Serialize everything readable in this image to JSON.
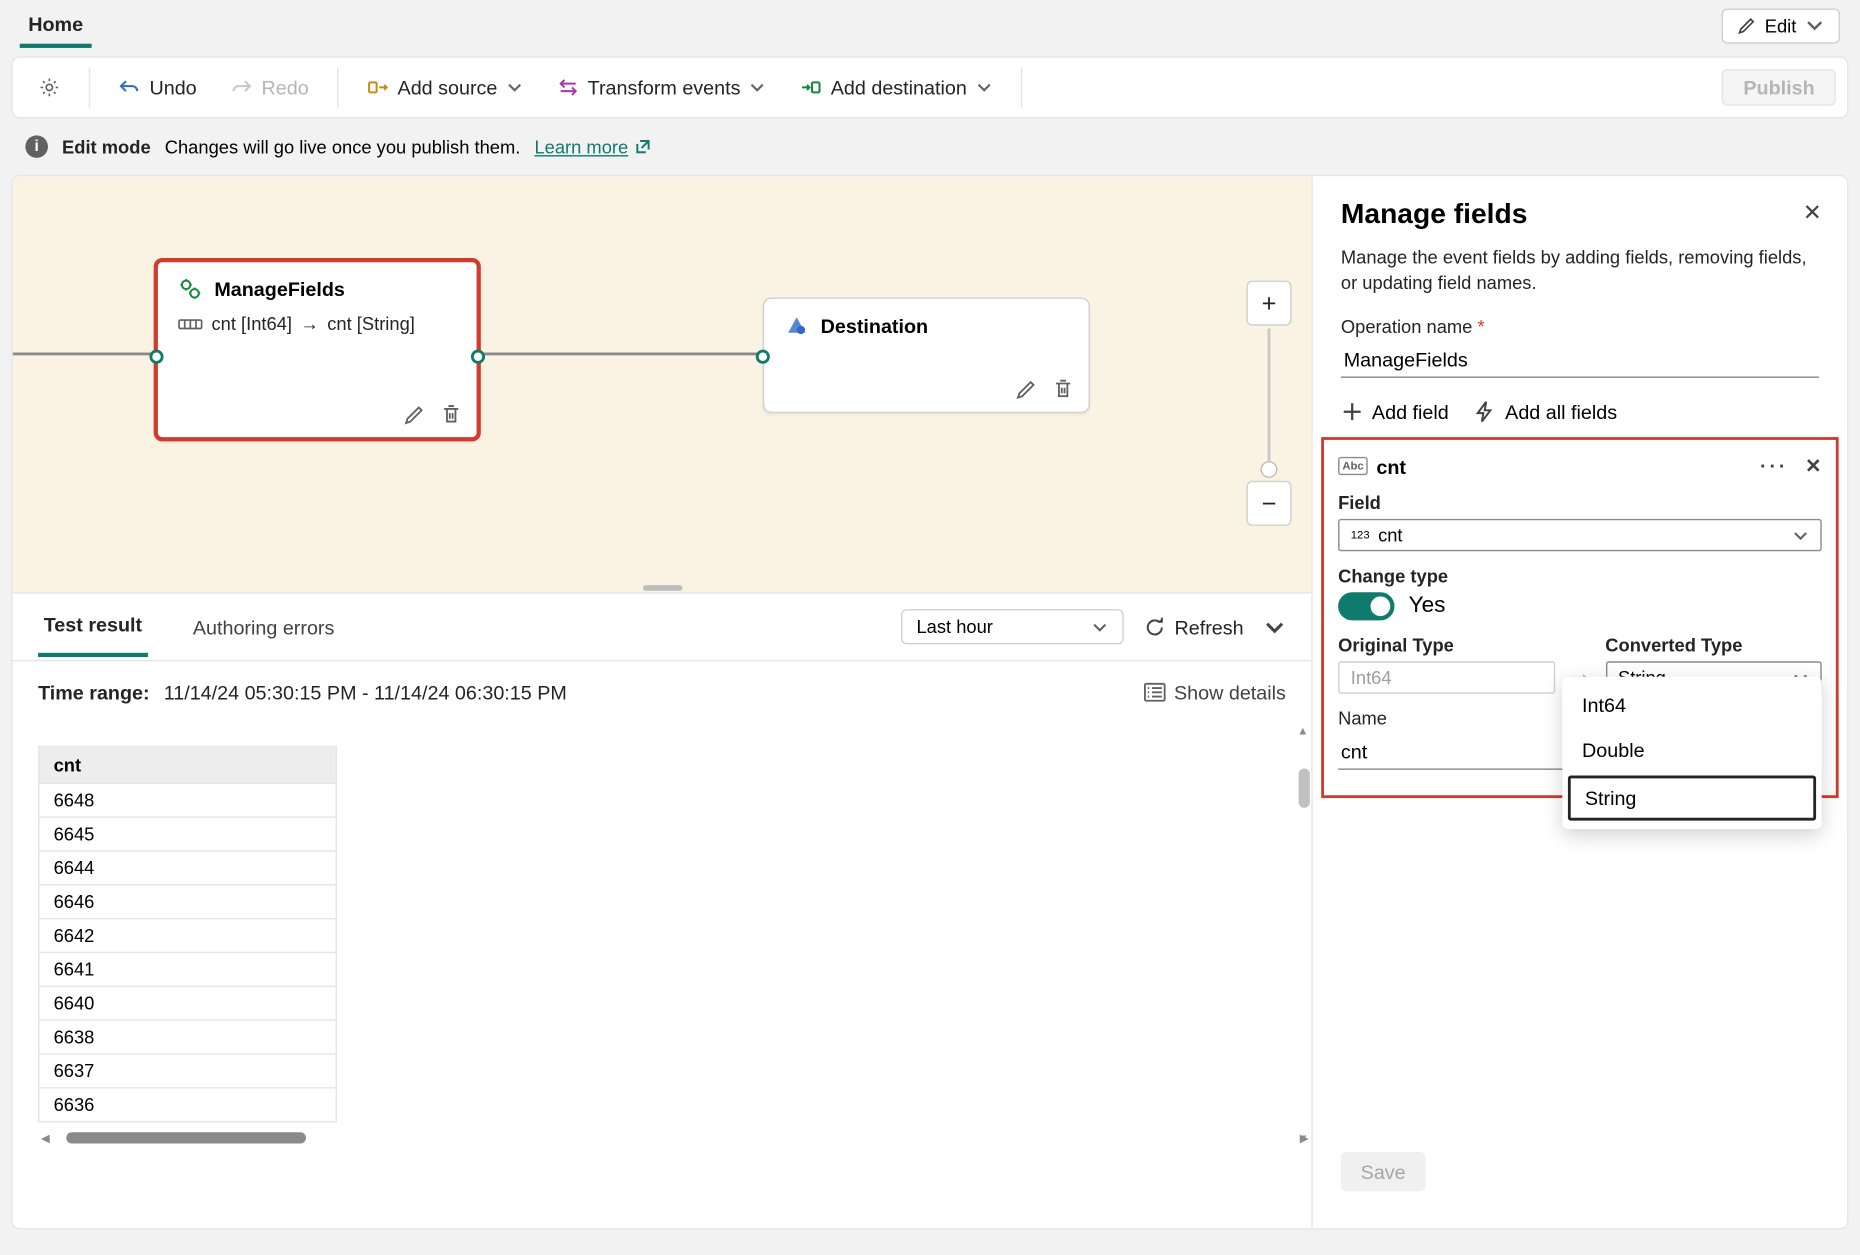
{
  "tabs": {
    "home": "Home"
  },
  "top_edit": "Edit",
  "toolbar": {
    "undo": "Undo",
    "redo": "Redo",
    "add_source": "Add source",
    "transform": "Transform events",
    "add_dest": "Add destination",
    "publish": "Publish"
  },
  "info": {
    "mode": "Edit mode",
    "msg": "Changes will go live once you publish them.",
    "link": "Learn more"
  },
  "nodes": {
    "manage": {
      "title": "ManageFields",
      "body_left": "cnt [Int64]",
      "body_right": "cnt [String]"
    },
    "dest": {
      "title": "Destination"
    }
  },
  "result_tabs": {
    "test": "Test result",
    "errors": "Authoring errors"
  },
  "time_range_label": "Time range:",
  "time_range_value": "11/14/24 05:30:15 PM  -  11/14/24 06:30:15 PM",
  "time_sel": "Last hour",
  "refresh": "Refresh",
  "show_details": "Show details",
  "table": {
    "col": "cnt",
    "rows": [
      "6648",
      "6645",
      "6644",
      "6646",
      "6642",
      "6641",
      "6640",
      "6638",
      "6637",
      "6636"
    ]
  },
  "panel": {
    "title": "Manage fields",
    "desc": "Manage the event fields by adding fields, removing fields, or updating field names.",
    "op_label": "Operation name",
    "op_value": "ManageFields",
    "add_field": "Add field",
    "add_all": "Add all fields",
    "card": {
      "name": "cnt",
      "field_lbl": "Field",
      "field_val": "cnt",
      "change_lbl": "Change type",
      "yes": "Yes",
      "orig_lbl": "Original Type",
      "orig_val": "Int64",
      "conv_lbl": "Converted Type",
      "conv_val": "String",
      "name_lbl": "Name",
      "name_val": "cnt",
      "options": [
        "Int64",
        "Double",
        "String"
      ],
      "selected_option": "String"
    },
    "save": "Save"
  }
}
